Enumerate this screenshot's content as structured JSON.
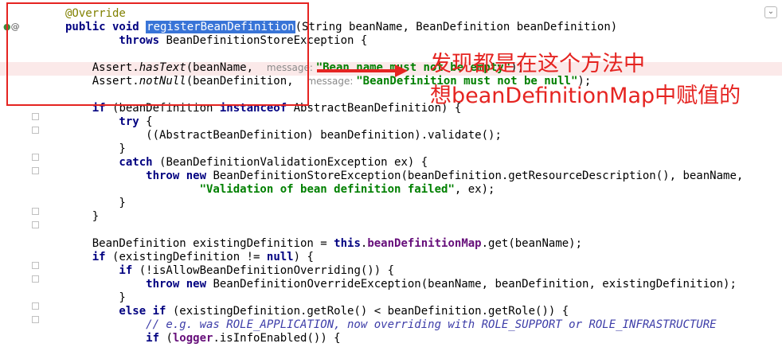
{
  "editor": {
    "gutter_override_icon": "@",
    "code_lines": [
      {
        "segments": [
          {
            "t": "@Override",
            "c": "ann"
          }
        ]
      },
      {
        "segments": [
          {
            "t": "public void ",
            "c": "kw"
          },
          {
            "t": "registerBeanDefinition",
            "c": "sel"
          },
          {
            "t": "(String beanName, BeanDefinition beanDefinition)",
            "c": ""
          }
        ]
      },
      {
        "segments": [
          {
            "t": "        throws ",
            "c": "kw"
          },
          {
            "t": "BeanDefinitionStoreException {",
            "c": ""
          }
        ]
      },
      {
        "segments": []
      },
      {
        "segments": [
          {
            "t": "    Assert.",
            "c": ""
          },
          {
            "t": "hasText",
            "c": "it"
          },
          {
            "t": "(beanName,  ",
            "c": ""
          },
          {
            "t": "message: ",
            "c": "hint"
          },
          {
            "t": "\"Bean name must not be empty\"",
            "c": "str"
          },
          {
            "t": ");",
            "c": ""
          }
        ]
      },
      {
        "segments": [
          {
            "t": "    Assert.",
            "c": ""
          },
          {
            "t": "notNull",
            "c": "it"
          },
          {
            "t": "(beanDefinition,  ",
            "c": ""
          },
          {
            "t": "message: ",
            "c": "hint"
          },
          {
            "t": "\"BeanDefinition must not be null\"",
            "c": "str"
          },
          {
            "t": ");",
            "c": ""
          }
        ]
      },
      {
        "segments": []
      },
      {
        "segments": [
          {
            "t": "    if ",
            "c": "kw"
          },
          {
            "t": "(beanDefinition ",
            "c": ""
          },
          {
            "t": "instanceof ",
            "c": "kw"
          },
          {
            "t": "AbstractBeanDefinition) {",
            "c": ""
          }
        ]
      },
      {
        "segments": [
          {
            "t": "        try ",
            "c": "kw"
          },
          {
            "t": "{",
            "c": ""
          }
        ]
      },
      {
        "segments": [
          {
            "t": "            ((AbstractBeanDefinition) beanDefinition).validate();",
            "c": ""
          }
        ]
      },
      {
        "segments": [
          {
            "t": "        }",
            "c": ""
          }
        ]
      },
      {
        "segments": [
          {
            "t": "        catch ",
            "c": "kw"
          },
          {
            "t": "(BeanDefinitionValidationException ex) {",
            "c": ""
          }
        ]
      },
      {
        "segments": [
          {
            "t": "            throw new ",
            "c": "kw"
          },
          {
            "t": "BeanDefinitionStoreException(beanDefinition.getResourceDescription(), beanName,",
            "c": ""
          }
        ]
      },
      {
        "segments": [
          {
            "t": "                    ",
            "c": ""
          },
          {
            "t": "\"Validation of bean definition failed\"",
            "c": "str"
          },
          {
            "t": ", ex);",
            "c": ""
          }
        ]
      },
      {
        "segments": [
          {
            "t": "        }",
            "c": ""
          }
        ]
      },
      {
        "segments": [
          {
            "t": "    }",
            "c": ""
          }
        ]
      },
      {
        "segments": []
      },
      {
        "segments": [
          {
            "t": "    BeanDefinition existingDefinition = ",
            "c": ""
          },
          {
            "t": "this",
            "c": "kw"
          },
          {
            "t": ".",
            "c": ""
          },
          {
            "t": "beanDefinitionMap",
            "c": "fld"
          },
          {
            "t": ".get(beanName);",
            "c": ""
          }
        ]
      },
      {
        "segments": [
          {
            "t": "    if ",
            "c": "kw"
          },
          {
            "t": "(existingDefinition != ",
            "c": ""
          },
          {
            "t": "null",
            "c": "kw"
          },
          {
            "t": ") {",
            "c": ""
          }
        ]
      },
      {
        "segments": [
          {
            "t": "        if ",
            "c": "kw"
          },
          {
            "t": "(!isAllowBeanDefinitionOverriding()) {",
            "c": ""
          }
        ]
      },
      {
        "segments": [
          {
            "t": "            throw new ",
            "c": "kw"
          },
          {
            "t": "BeanDefinitionOverrideException(beanName, beanDefinition, existingDefinition);",
            "c": ""
          }
        ]
      },
      {
        "segments": [
          {
            "t": "        }",
            "c": ""
          }
        ]
      },
      {
        "segments": [
          {
            "t": "        else if ",
            "c": "kw"
          },
          {
            "t": "(existingDefinition.getRole() < beanDefinition.getRole()) {",
            "c": ""
          }
        ]
      },
      {
        "segments": [
          {
            "t": "            // e.g. was ROLE_APPLICATION, now overriding with ROLE_SUPPORT or ROLE_INFRASTRUCTURE",
            "c": "cmt"
          }
        ]
      },
      {
        "segments": [
          {
            "t": "            if ",
            "c": "kw"
          },
          {
            "t": "(",
            "c": ""
          },
          {
            "t": "logger",
            "c": "fld"
          },
          {
            "t": ".isInfoEnabled()) {",
            "c": ""
          }
        ]
      }
    ]
  },
  "annotation": {
    "line1": "发现都是在这个方法中",
    "line2": "想beanDefinitionMap中赋值的",
    "color": "#e52421"
  }
}
